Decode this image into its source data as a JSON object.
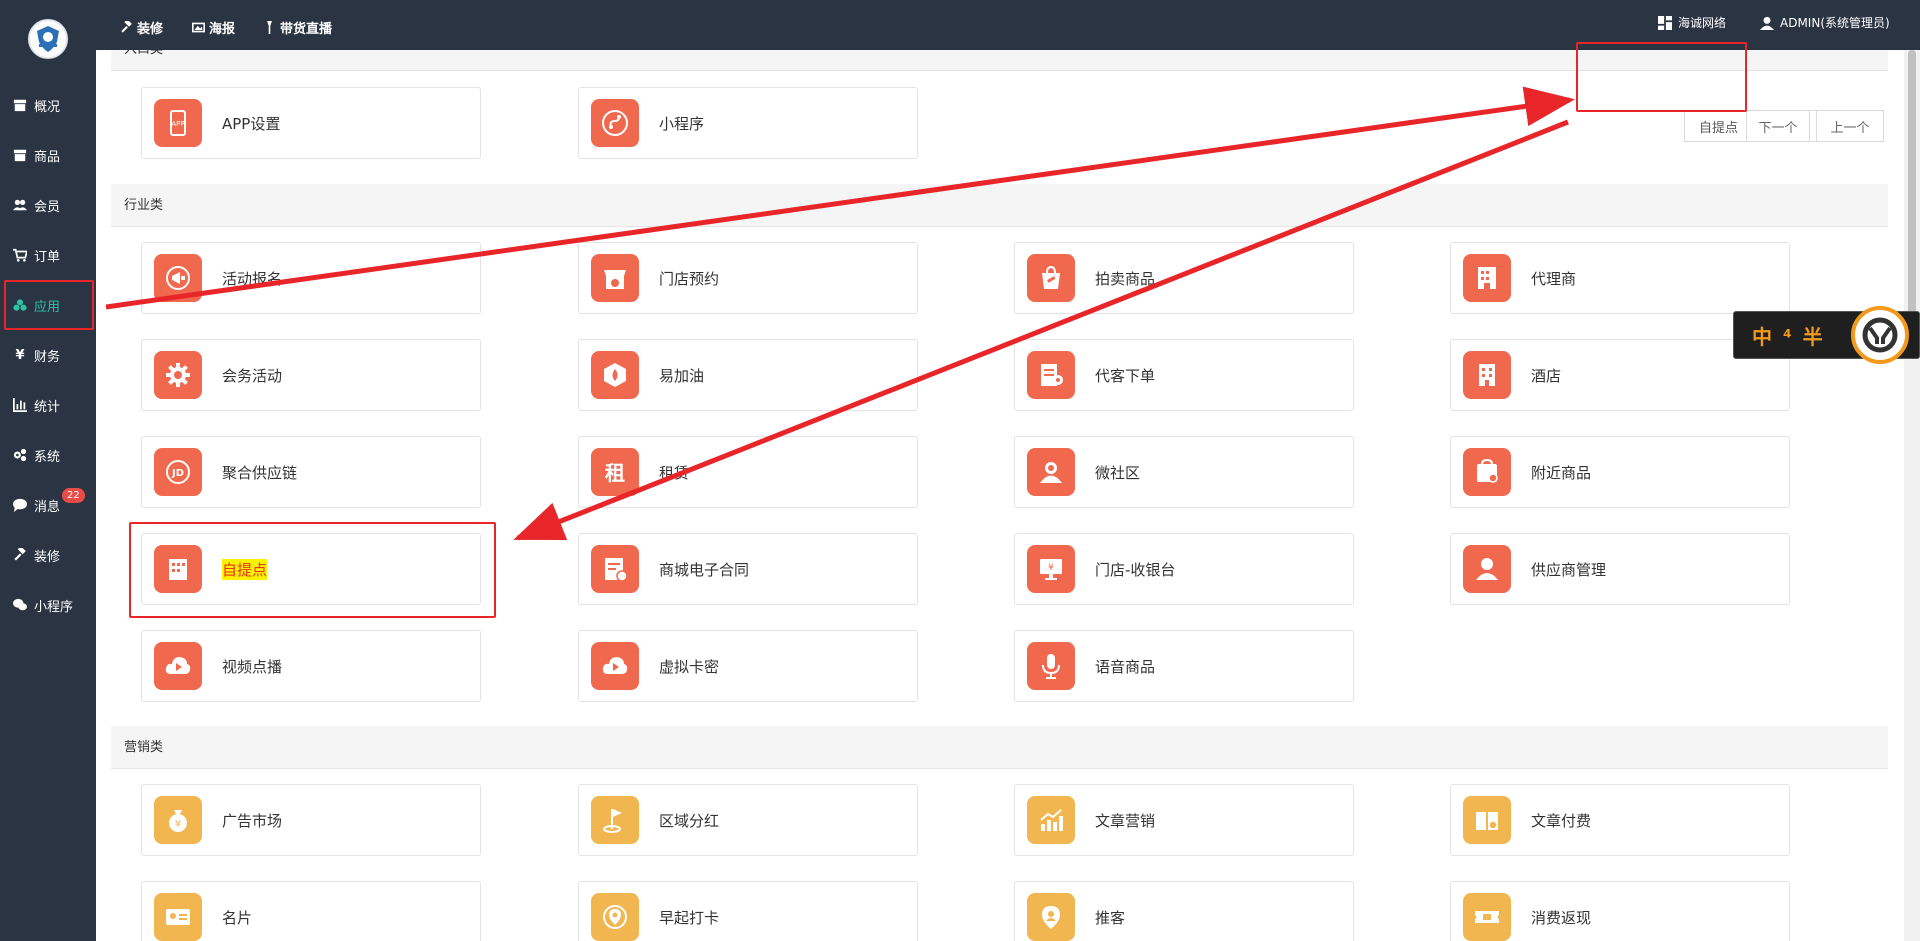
{
  "sidebar": {
    "items": [
      {
        "label": "概况",
        "icon": "archive-icon",
        "active": false
      },
      {
        "label": "商品",
        "icon": "archive-icon",
        "active": false
      },
      {
        "label": "会员",
        "icon": "users-icon",
        "active": false
      },
      {
        "label": "订单",
        "icon": "cart-icon",
        "active": false
      },
      {
        "label": "应用",
        "icon": "cubes-icon",
        "active": true
      },
      {
        "label": "财务",
        "icon": "yen-icon",
        "active": false
      },
      {
        "label": "统计",
        "icon": "bar-chart-icon",
        "active": false
      },
      {
        "label": "系统",
        "icon": "gears-icon",
        "active": false
      },
      {
        "label": "消息",
        "icon": "comment-icon",
        "active": false,
        "badge": "22"
      },
      {
        "label": "装修",
        "icon": "gavel-icon",
        "active": false
      },
      {
        "label": "小程序",
        "icon": "wechat-icon",
        "active": false
      }
    ]
  },
  "topbar": {
    "links": [
      "装修",
      "海报",
      "带货直播"
    ],
    "company": "海诚网络",
    "user": "ADMIN(系统管理员)"
  },
  "search": {
    "value": "自提点",
    "next_label": "下一个",
    "prev_label": "上一个"
  },
  "sections": {
    "entry": {
      "title": "入口类",
      "items": [
        "APP设置",
        "小程序"
      ]
    },
    "industry": {
      "title": "行业类",
      "items": [
        "活动报名",
        "门店预约",
        "拍卖商品",
        "代理商",
        "会务活动",
        "易加油",
        "代客下单",
        "酒店",
        "聚合供应链",
        "租赁",
        "微社区",
        "附近商品",
        "自提点",
        "商城电子合同",
        "门店-收银台",
        "供应商管理",
        "视频点播",
        "虚拟卡密",
        "语音商品"
      ]
    },
    "marketing": {
      "title": "营销类",
      "items": [
        "广告市场",
        "区域分红",
        "文章营销",
        "文章付费",
        "名片",
        "早起打卡",
        "推客",
        "消费返现"
      ]
    }
  },
  "widget": {
    "text": "中 ⁴ 半"
  },
  "colors": {
    "sidebar_bg": "#2b3442",
    "active": "#2bc3a6",
    "icon_orange": "#f0694f",
    "icon_yellow": "#f2b650",
    "annotation_red": "#e8262a",
    "badge": "#e94b47"
  }
}
